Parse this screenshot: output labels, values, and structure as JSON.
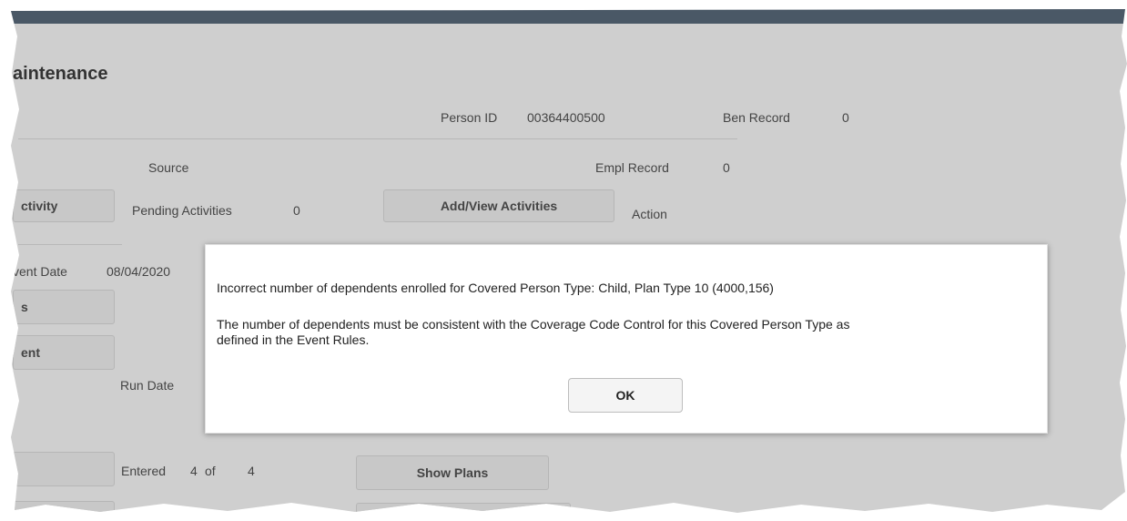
{
  "page": {
    "title": "aintenance",
    "person_id_label": "Person ID",
    "person_id_value": "00364400500",
    "ben_record_label": "Ben Record",
    "ben_record_value": "0",
    "source_label": "Source",
    "empl_record_label": "Empl Record",
    "empl_record_value": "0",
    "activity_button": "ctivity",
    "pending_label": "Pending Activities",
    "pending_value": "0",
    "add_view_button": "Add/View Activities",
    "action_label": "Action",
    "event_date_label": "vent Date",
    "event_date_value": "08/04/2020",
    "s_button": "s",
    "ent_button": "ent",
    "run_date_label": "Run Date",
    "entered_label": "Entered",
    "entered_value": "4",
    "of_label": "of",
    "total_value": "4",
    "show_plans_button": "Show Plans"
  },
  "modal": {
    "line1": "Incorrect number of dependents enrolled for Covered Person Type: Child, Plan Type 10 (4000,156)",
    "line2a": "The number of dependents must be consistent with the Coverage Code Control for this Covered Person Type as",
    "line2b": "defined in the Event Rules.",
    "ok_label": "OK"
  }
}
